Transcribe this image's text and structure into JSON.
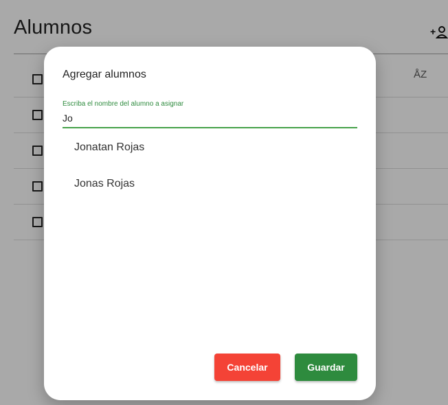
{
  "page": {
    "title": "Alumnos",
    "icons": {
      "add": "person-add-icon",
      "sort": "sort-alpha-icon",
      "sort_glyph": "ÅZ"
    }
  },
  "dialog": {
    "title": "Agregar alumnos",
    "field_label": "Escriba el nombre del alumno a asignar",
    "field_value": "Jo",
    "options": [
      "Jonatan Rojas",
      "Jonas Rojas"
    ],
    "cancel_label": "Cancelar",
    "save_label": "Guardar"
  },
  "colors": {
    "accent": "#2e8b3e",
    "danger": "#f44336",
    "field_line": "#43a047"
  }
}
